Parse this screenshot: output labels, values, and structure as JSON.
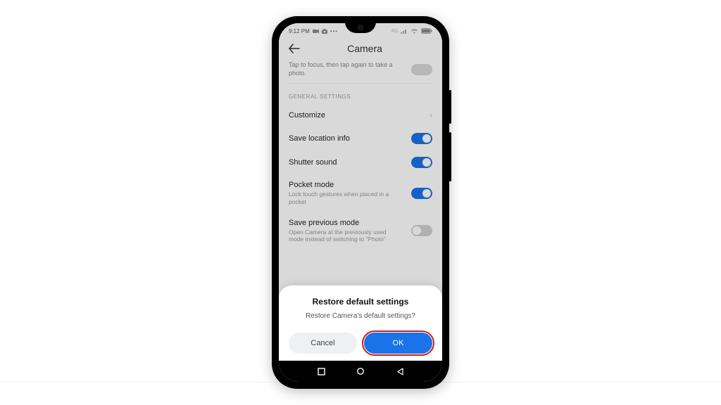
{
  "statusbar": {
    "time": "9:12 PM"
  },
  "appbar": {
    "title": "Camera"
  },
  "truncated": {
    "line1": "Tap to focus, then tap again to take a",
    "line2": "photo."
  },
  "section_label": "GENERAL SETTINGS",
  "rows": {
    "customize": {
      "label": "Customize"
    },
    "save_location": {
      "label": "Save location info",
      "on": true
    },
    "shutter_sound": {
      "label": "Shutter sound",
      "on": true
    },
    "pocket_mode": {
      "label": "Pocket mode",
      "sub": "Lock touch gestures when placed in a pocket",
      "on": true
    },
    "save_previous": {
      "label": "Save previous mode",
      "sub": "Open Camera at the previously used mode instead of switching to \"Photo\"",
      "on": false
    }
  },
  "dialog": {
    "title": "Restore default settings",
    "message": "Restore Camera's default settings?",
    "cancel": "Cancel",
    "ok": "OK"
  }
}
